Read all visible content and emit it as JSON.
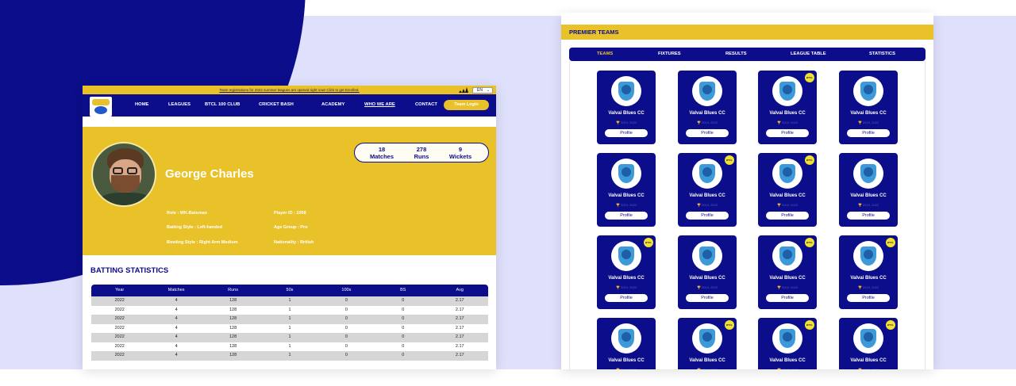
{
  "left": {
    "announcement": "Team registrations for 2022 summer leagues are opened right now! Click to get Enrolled.",
    "language": "EN",
    "nav": [
      "HOME",
      "LEAGUES",
      "BTCL 100 CLUB",
      "CRICKET BASH",
      "ACADEMY",
      "WHO WE ARE",
      "CONTACT"
    ],
    "login_label": "Team Login",
    "player": {
      "name": "George Charles",
      "stats": [
        {
          "value": "18",
          "label": "Matches"
        },
        {
          "value": "278",
          "label": "Runs"
        },
        {
          "value": "9",
          "label": "Wickets"
        }
      ],
      "info": {
        "role": "Role : WK-Batsman",
        "player_id": "Player ID : 1058",
        "batting_style": "Batting Style : Left-handed",
        "age_group": "Age Group : Pro",
        "bowling_style": "Bowling Style : Right Arm Medium",
        "nationality": "Nationality : British"
      }
    },
    "batting": {
      "title": "BATTING STATISTICS",
      "headers": [
        "Year",
        "Matches",
        "Runs",
        "50s",
        "100s",
        "BS",
        "Avg"
      ],
      "rows": [
        [
          "2022",
          "4",
          "128",
          "1",
          "0",
          "0",
          "2.17"
        ],
        [
          "2022",
          "4",
          "128",
          "1",
          "0",
          "0",
          "2.17"
        ],
        [
          "2022",
          "4",
          "128",
          "1",
          "0",
          "0",
          "2.17"
        ],
        [
          "2022",
          "4",
          "128",
          "1",
          "0",
          "0",
          "2.17"
        ],
        [
          "2022",
          "4",
          "128",
          "1",
          "0",
          "0",
          "2.17"
        ],
        [
          "2022",
          "4",
          "128",
          "1",
          "0",
          "0",
          "2.17"
        ],
        [
          "2022",
          "4",
          "128",
          "1",
          "0",
          "0",
          "2.17"
        ]
      ]
    }
  },
  "right": {
    "title": "PREMIER TEAMS",
    "tabs": [
      "TEAMS",
      "FIXTURES",
      "RESULTS",
      "LEAGUE TABLE",
      "STATISTICS"
    ],
    "selected_tab": "TEAMS",
    "card": {
      "name": "Valvai Blues CC",
      "sub": "2019, 2022",
      "button": "Profile",
      "badge": "BTCL 100"
    },
    "badge_flags": [
      [
        false,
        false,
        true,
        false
      ],
      [
        false,
        true,
        true,
        false
      ],
      [
        true,
        false,
        true,
        true
      ],
      [
        false,
        true,
        true,
        true
      ]
    ]
  },
  "colors": {
    "navy": "#0b0d8a",
    "yellow": "#e9c129",
    "lavender": "#dfe0fb",
    "row_grey": "#d6d6d6"
  }
}
